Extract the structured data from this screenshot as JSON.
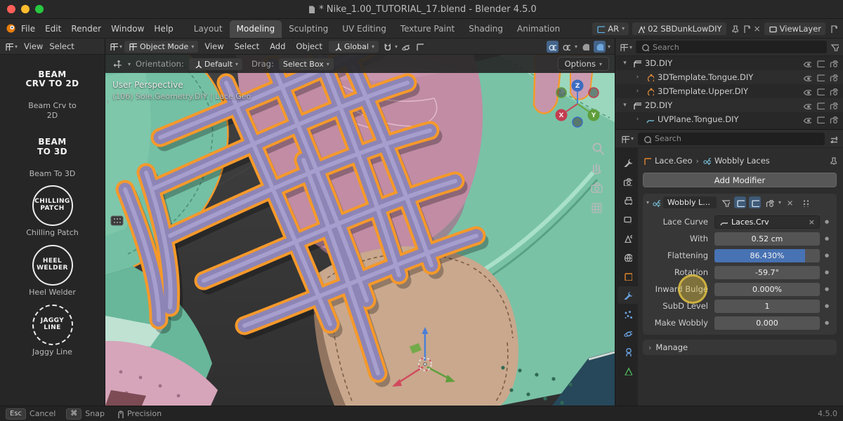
{
  "titlebar": {
    "title": "* Nike_1.00_TUTORIAL_17.blend - Blender 4.5.0"
  },
  "topbar": {
    "menus": [
      "File",
      "Edit",
      "Render",
      "Window",
      "Help"
    ],
    "workspaces": [
      "Layout",
      "Modeling",
      "Sculpting",
      "UV Editing",
      "Texture Paint",
      "Shading",
      "Animation"
    ],
    "active_workspace": "Modeling",
    "scene_selector": "AR",
    "scene_name": "02 SBDunkLowDIY",
    "view_layer": "ViewLayer"
  },
  "tool_shelf": {
    "menus": [
      "View",
      "Select"
    ],
    "tools": [
      {
        "thumb": "BEAM\nCRV TO 2D",
        "caption": "Beam Crv to 2D"
      },
      {
        "thumb": "BEAM\nTO 3D",
        "caption": "Beam To 3D"
      },
      {
        "thumb": "CHILLING\nPATCH",
        "caption": "Chilling Patch"
      },
      {
        "thumb": "HEEL\nWELDER",
        "caption": "Heel Welder"
      },
      {
        "thumb": "JAGGY\nLINE",
        "caption": "Jaggy Line"
      }
    ]
  },
  "viewport": {
    "header": {
      "mode": "Object Mode",
      "menus": [
        "View",
        "Select",
        "Add",
        "Object"
      ],
      "orientation": "Global"
    },
    "tool_settings": {
      "orientation_label": "Orientation:",
      "orientation_value": "Default",
      "drag_label": "Drag:",
      "drag_value": "Select Box",
      "options_label": "Options"
    },
    "overlay": {
      "perspective": "User Perspective",
      "context": "(106) Sole.Geometry.DIY | Lace.Geo"
    },
    "axes": {
      "x": "X",
      "y": "Y",
      "z": "Z"
    }
  },
  "outliner": {
    "search_placeholder": "Search",
    "rows": [
      {
        "name": "3D.DIY",
        "kind": "collection"
      },
      {
        "name": "3DTemplate.Tongue.DIY",
        "kind": "object"
      },
      {
        "name": "3DTemplate.Upper.DIY",
        "kind": "object"
      },
      {
        "name": "2D.DIY",
        "kind": "collection"
      },
      {
        "name": "UVPlane.Tongue.DIY",
        "kind": "object"
      }
    ]
  },
  "properties": {
    "search_placeholder": "Search",
    "tabs": [
      "tool",
      "render",
      "output",
      "view-layer",
      "scene",
      "world",
      "object",
      "modifiers",
      "particles",
      "physics",
      "constraints",
      "data"
    ],
    "active_tab": "modifiers",
    "breadcrumb": {
      "object": "Lace.Geo",
      "modifier": "Wobbly Laces"
    },
    "add_modifier_label": "Add Modifier",
    "modifier": {
      "name": "Wobbly La...",
      "rows": [
        {
          "label": "Lace Curve",
          "value": "Laces.Crv"
        },
        {
          "label": "With",
          "value": "0.52 cm"
        },
        {
          "label": "Flattening",
          "value": "86.430%",
          "slider_fill": "86%"
        },
        {
          "label": "Rotation",
          "value": "-59.7°"
        },
        {
          "label": "Inward Bulge",
          "value": "0.000%"
        },
        {
          "label": "SubD Level",
          "value": "1"
        },
        {
          "label": "Make Wobbly",
          "value": "0.000"
        }
      ],
      "manage_label": "Manage"
    }
  },
  "statusbar": {
    "hints": [
      {
        "key": "Esc",
        "label": "Cancel"
      },
      {
        "key": "⌘",
        "label": "Snap"
      },
      {
        "key": "",
        "icon": "mouse-icon",
        "label": "Precision"
      }
    ],
    "version": "4.5.0"
  }
}
